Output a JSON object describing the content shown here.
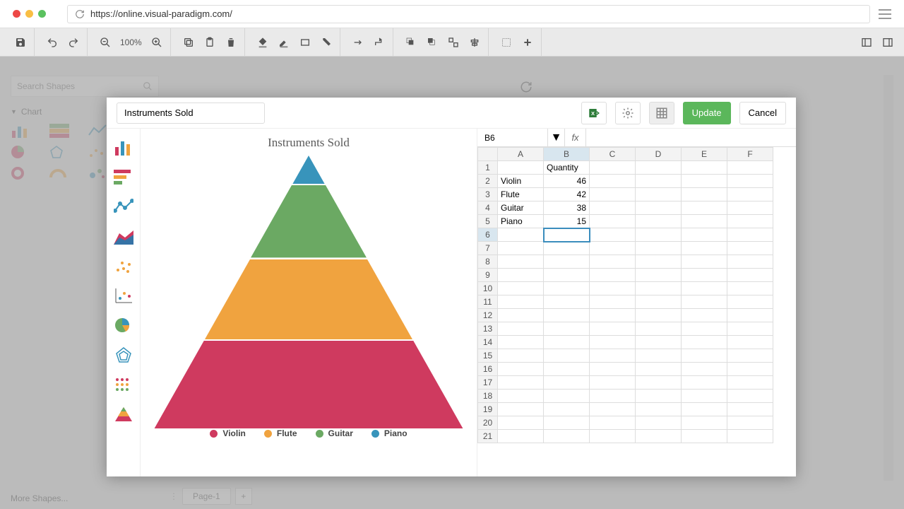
{
  "browser": {
    "url": "https://online.visual-paradigm.com/"
  },
  "toolbar": {
    "zoom": "100%"
  },
  "sidebar": {
    "search_placeholder": "Search Shapes",
    "section": "Chart",
    "more": "More Shapes..."
  },
  "pages": {
    "tab1": "Page-1"
  },
  "modal": {
    "title": "Instruments Sold",
    "update": "Update",
    "cancel": "Cancel"
  },
  "chart_data": {
    "type": "pyramid",
    "title": "Instruments Sold",
    "series_header": "Quantity",
    "categories": [
      "Violin",
      "Flute",
      "Guitar",
      "Piano"
    ],
    "values": [
      46,
      42,
      38,
      15
    ],
    "colors": [
      "#cf3a5f",
      "#f0a33f",
      "#6ba963",
      "#3894bb"
    ]
  },
  "sheet": {
    "cell_ref": "B6",
    "fx": "fx",
    "cols": [
      "A",
      "B",
      "C",
      "D",
      "E",
      "F"
    ],
    "row_count": 21,
    "selected": {
      "row": 6,
      "col": 1
    },
    "rows": [
      [
        "",
        "Quantity",
        "",
        "",
        "",
        ""
      ],
      [
        "Violin",
        "46",
        "",
        "",
        "",
        ""
      ],
      [
        "Flute",
        "42",
        "",
        "",
        "",
        ""
      ],
      [
        "Guitar",
        "38",
        "",
        "",
        "",
        ""
      ],
      [
        "Piano",
        "15",
        "",
        "",
        "",
        ""
      ]
    ]
  }
}
